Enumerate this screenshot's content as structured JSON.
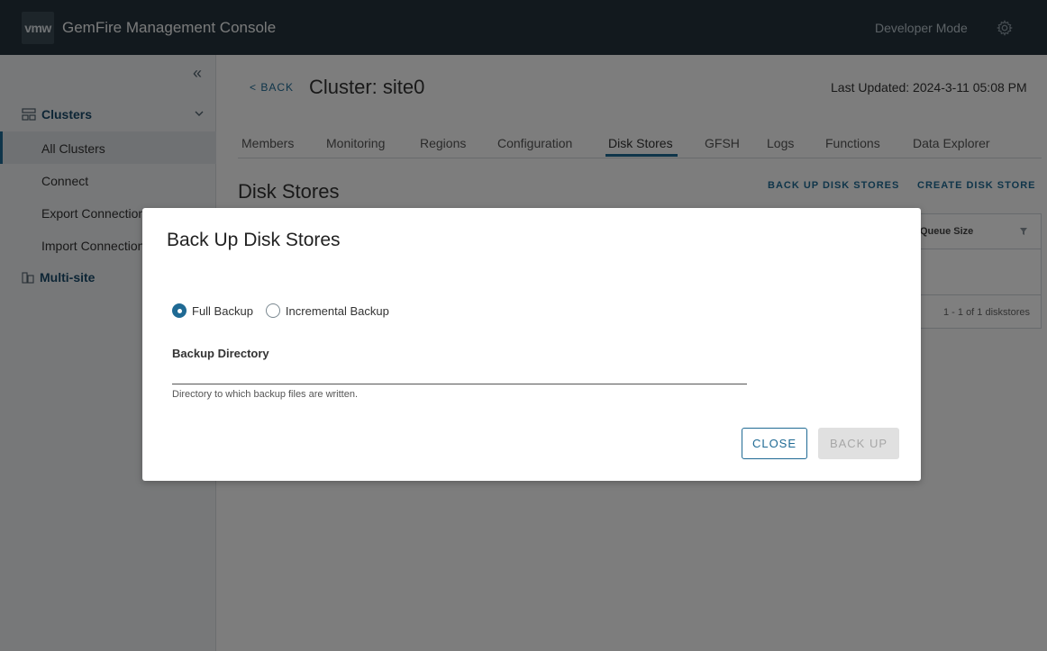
{
  "header": {
    "logo_text": "vmw",
    "title": "GemFire Management Console",
    "mode": "Developer Mode",
    "settings_icon": "gear-icon"
  },
  "sidebar": {
    "collapse_icon": "double-chevron-left-icon",
    "clusters_label": "Clusters",
    "items": [
      {
        "label": "All Clusters",
        "active": true
      },
      {
        "label": "Connect"
      },
      {
        "label": "Export Connections"
      },
      {
        "label": "Import Connections"
      }
    ],
    "multisite_label": "Multi-site"
  },
  "page": {
    "back_label": "< BACK",
    "title": "Cluster: site0",
    "last_updated": "Last Updated: 2024-3-11 05:08 PM"
  },
  "tabs": [
    {
      "label": "Members"
    },
    {
      "label": "Monitoring"
    },
    {
      "label": "Regions"
    },
    {
      "label": "Configuration"
    },
    {
      "label": "Disk Stores",
      "active": true
    },
    {
      "label": "GFSH"
    },
    {
      "label": "Logs"
    },
    {
      "label": "Functions"
    },
    {
      "label": "Data Explorer"
    }
  ],
  "section": {
    "title": "Disk Stores",
    "backup_action": "BACK UP DISK STORES",
    "create_action": "CREATE DISK STORE"
  },
  "grid": {
    "column": "Queue Size",
    "footer": "1 - 1 of 1 diskstores"
  },
  "modal": {
    "title": "Back Up Disk Stores",
    "options": [
      {
        "label": "Full Backup",
        "checked": true
      },
      {
        "label": "Incremental Backup",
        "checked": false
      }
    ],
    "field_label": "Backup Directory",
    "field_value": "",
    "field_help": "Directory to which backup files are written.",
    "close_label": "CLOSE",
    "backup_label": "BACK UP"
  },
  "colors": {
    "header_bg": "#25333d",
    "accent": "#1f6a94"
  }
}
